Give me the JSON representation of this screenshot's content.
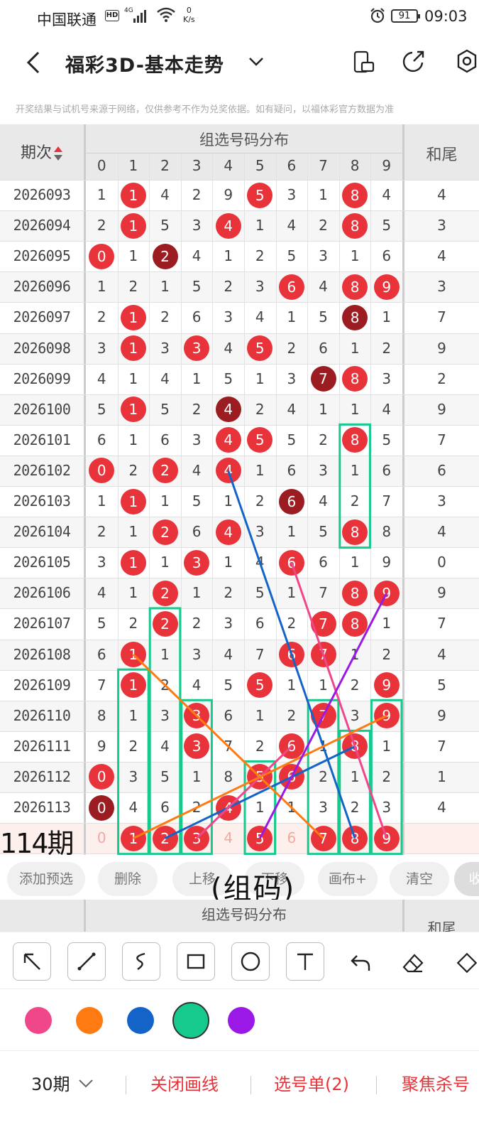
{
  "status": {
    "carrier": "中国联通",
    "hd": "HD",
    "net": "4G",
    "speed_value": "0",
    "speed_unit": "K/s",
    "battery": "91",
    "time": "09:03"
  },
  "appbar": {
    "title": "福彩3D-基本走势",
    "icons": [
      "back-arrow-icon",
      "chevron-down-icon",
      "phone-rotate-icon",
      "share-icon",
      "settings-icon"
    ]
  },
  "notice": "开奖结果与试机号来源于网络，仅供参考不作为兑奖依据。如有疑问，以福体彩官方数据为准",
  "table": {
    "col_period": "期次",
    "col_dist": "组选号码分布",
    "col_tail": "和尾",
    "digits": [
      "0",
      "1",
      "2",
      "3",
      "4",
      "5",
      "6",
      "7",
      "8",
      "9"
    ],
    "rows": [
      {
        "period": "2026093",
        "cells": [
          "1",
          "1",
          "4",
          "2",
          "9",
          "5",
          "3",
          "1",
          "8",
          "4"
        ],
        "hits": {
          "1": "r",
          "5": "r",
          "8": "r"
        },
        "tail": "4"
      },
      {
        "period": "2026094",
        "cells": [
          "2",
          "1",
          "5",
          "3",
          "4",
          "1",
          "4",
          "2",
          "8",
          "5"
        ],
        "hits": {
          "1": "r",
          "4": "r",
          "8": "r"
        },
        "tail": "3"
      },
      {
        "period": "2026095",
        "cells": [
          "0",
          "1",
          "2",
          "4",
          "1",
          "2",
          "5",
          "3",
          "1",
          "6"
        ],
        "hits": {
          "0": "r",
          "2": "d"
        },
        "tail": "4"
      },
      {
        "period": "2026096",
        "cells": [
          "1",
          "2",
          "1",
          "5",
          "2",
          "3",
          "6",
          "4",
          "8",
          "9"
        ],
        "hits": {
          "6": "r",
          "8": "r",
          "9": "r"
        },
        "tail": "3"
      },
      {
        "period": "2026097",
        "cells": [
          "2",
          "1",
          "2",
          "6",
          "3",
          "4",
          "1",
          "5",
          "8",
          "1"
        ],
        "hits": {
          "1": "r",
          "8": "d"
        },
        "tail": "7"
      },
      {
        "period": "2026098",
        "cells": [
          "3",
          "1",
          "3",
          "3",
          "4",
          "5",
          "2",
          "6",
          "1",
          "2"
        ],
        "hits": {
          "1": "r",
          "3": "r",
          "5": "r"
        },
        "tail": "9"
      },
      {
        "period": "2026099",
        "cells": [
          "4",
          "1",
          "4",
          "1",
          "5",
          "1",
          "3",
          "7",
          "8",
          "3"
        ],
        "hits": {
          "7": "d",
          "8": "r"
        },
        "tail": "2"
      },
      {
        "period": "2026100",
        "cells": [
          "5",
          "1",
          "5",
          "2",
          "4",
          "2",
          "4",
          "1",
          "1",
          "4"
        ],
        "hits": {
          "1": "r",
          "4": "d"
        },
        "tail": "9"
      },
      {
        "period": "2026101",
        "cells": [
          "6",
          "1",
          "6",
          "3",
          "4",
          "5",
          "5",
          "2",
          "8",
          "5"
        ],
        "hits": {
          "4": "r",
          "5": "r",
          "8": "r"
        },
        "tail": "7"
      },
      {
        "period": "2026102",
        "cells": [
          "0",
          "2",
          "2",
          "4",
          "4",
          "1",
          "6",
          "3",
          "1",
          "6"
        ],
        "hits": {
          "0": "r",
          "2": "r",
          "4": "r"
        },
        "tail": "6"
      },
      {
        "period": "2026103",
        "cells": [
          "1",
          "1",
          "1",
          "5",
          "1",
          "2",
          "6",
          "4",
          "2",
          "7"
        ],
        "hits": {
          "1": "r",
          "6": "d"
        },
        "tail": "3"
      },
      {
        "period": "2026104",
        "cells": [
          "2",
          "1",
          "2",
          "6",
          "4",
          "3",
          "1",
          "5",
          "8",
          "8"
        ],
        "hits": {
          "2": "r",
          "4": "r",
          "8": "r"
        },
        "tail": "4"
      },
      {
        "period": "2026105",
        "cells": [
          "3",
          "1",
          "1",
          "3",
          "1",
          "4",
          "6",
          "6",
          "1",
          "9"
        ],
        "hits": {
          "1": "r",
          "3": "r",
          "6": "r"
        },
        "tail": "0"
      },
      {
        "period": "2026106",
        "cells": [
          "4",
          "1",
          "2",
          "1",
          "2",
          "5",
          "1",
          "7",
          "8",
          "9"
        ],
        "hits": {
          "2": "r",
          "8": "r",
          "9": "r"
        },
        "tail": "9"
      },
      {
        "period": "2026107",
        "cells": [
          "5",
          "2",
          "2",
          "2",
          "3",
          "6",
          "2",
          "7",
          "8",
          "1"
        ],
        "hits": {
          "2": "r",
          "7": "r",
          "8": "r"
        },
        "tail": "7"
      },
      {
        "period": "2026108",
        "cells": [
          "6",
          "1",
          "1",
          "3",
          "4",
          "7",
          "6",
          "7",
          "1",
          "2"
        ],
        "hits": {
          "1": "r",
          "6": "r",
          "7": "r"
        },
        "tail": "4"
      },
      {
        "period": "2026109",
        "cells": [
          "7",
          "1",
          "2",
          "4",
          "5",
          "5",
          "1",
          "1",
          "2",
          "9"
        ],
        "hits": {
          "1": "r",
          "5": "r",
          "9": "r"
        },
        "tail": "5"
      },
      {
        "period": "2026110",
        "cells": [
          "8",
          "1",
          "3",
          "3",
          "6",
          "1",
          "2",
          "7",
          "3",
          "9"
        ],
        "hits": {
          "3": "r",
          "7": "r",
          "9": "r"
        },
        "tail": "9"
      },
      {
        "period": "2026111",
        "cells": [
          "9",
          "2",
          "4",
          "3",
          "7",
          "2",
          "6",
          "1",
          "8",
          "1"
        ],
        "hits": {
          "3": "r",
          "6": "r",
          "8": "r"
        },
        "tail": "7"
      },
      {
        "period": "2026112",
        "cells": [
          "0",
          "3",
          "5",
          "1",
          "8",
          "5",
          "6",
          "2",
          "1",
          "2"
        ],
        "hits": {
          "0": "r",
          "5": "r",
          "6": "r"
        },
        "tail": "1"
      },
      {
        "period": "2026113",
        "cells": [
          "0",
          "4",
          "6",
          "2",
          "4",
          "1",
          "1",
          "3",
          "2",
          "3"
        ],
        "hits": {
          "0": "d",
          "4": "r"
        },
        "tail": "4"
      }
    ],
    "predict": {
      "label": "114期",
      "cells": [
        "0",
        "1",
        "2",
        "3",
        "4",
        "5",
        "6",
        "7",
        "8",
        "9"
      ],
      "hits": {
        "1": "r",
        "2": "r",
        "3": "r",
        "5": "r",
        "7": "r",
        "8": "r",
        "9": "r"
      }
    }
  },
  "actions": [
    "添加预选",
    "删除",
    "上移",
    "下移",
    "画布+",
    "清空",
    "收"
  ],
  "handwriting": "(组码)",
  "tools": [
    "arrow-tool-icon",
    "line-tool-icon",
    "freehand-tool-icon",
    "rectangle-tool-icon",
    "circle-tool-icon",
    "text-tool-icon",
    "undo-icon",
    "eraser-icon",
    "more-tool-icon"
  ],
  "colors": [
    "#f0468a",
    "#ff7a10",
    "#1463c8",
    "#16c98d",
    "#9a19e6"
  ],
  "selected_color": "#16c98d",
  "bottom": {
    "periods": "30期",
    "close": "关闭画线",
    "list": "选号单(2)",
    "focus": "聚焦杀号"
  },
  "accent": "#e8333a"
}
